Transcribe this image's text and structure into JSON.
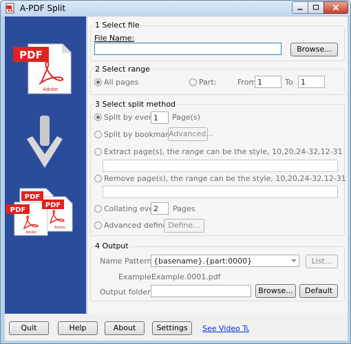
{
  "window": {
    "title": "A-PDF Split"
  },
  "illustration": {
    "pdf_label": "PDF",
    "adobe_label": "Adobe"
  },
  "select_file": {
    "legend": "1 Select file",
    "file_name_label": "File Name:",
    "file_name_value": "",
    "browse_label": "Browse..."
  },
  "select_range": {
    "legend": "2 Select range",
    "all_pages_label": "All pages",
    "all_pages_selected": true,
    "part_label": "Part:",
    "from_label": "From",
    "from_value": "1",
    "to_label": "To",
    "to_value": "1"
  },
  "split_method": {
    "legend": "3 Select split method",
    "split_every_label": "Split by every",
    "split_every_value": "1",
    "split_every_unit": "Page(s)",
    "split_every_selected": true,
    "split_bookmark_label": "Split by bookmark",
    "advanced_label": "Advanced...",
    "extract_label": "Extract page(s), the range can be the style, 10,20,24-32,12-31",
    "extract_value": "",
    "remove_label": "Remove page(s), the range can be the style, 10,20,24-32,12-31",
    "remove_value": "",
    "collating_label": "Collating every",
    "collating_value": "2",
    "collating_unit": "Pages",
    "advanced_define_label": "Advanced define",
    "define_label": "Define..."
  },
  "output": {
    "legend": "4 Output",
    "name_pattern_label": "Name Pattern:",
    "name_pattern_value": "{basename}.{part:0000}",
    "list_label": "List...",
    "example_label": "Example:",
    "example_value": "Example.0001.pdf",
    "output_folder_label": "Output folder:",
    "output_folder_value": "",
    "browse_label": "Browse...",
    "default_label": "Default"
  },
  "bottom": {
    "quit": "Quit",
    "help": "Help",
    "about": "About",
    "settings": "Settings",
    "video_link": "See Video Tutoria"
  },
  "colors": {
    "side_panel": "#2b4c9a",
    "pdf_red": "#e0231f",
    "link_blue": "#0033cc"
  }
}
